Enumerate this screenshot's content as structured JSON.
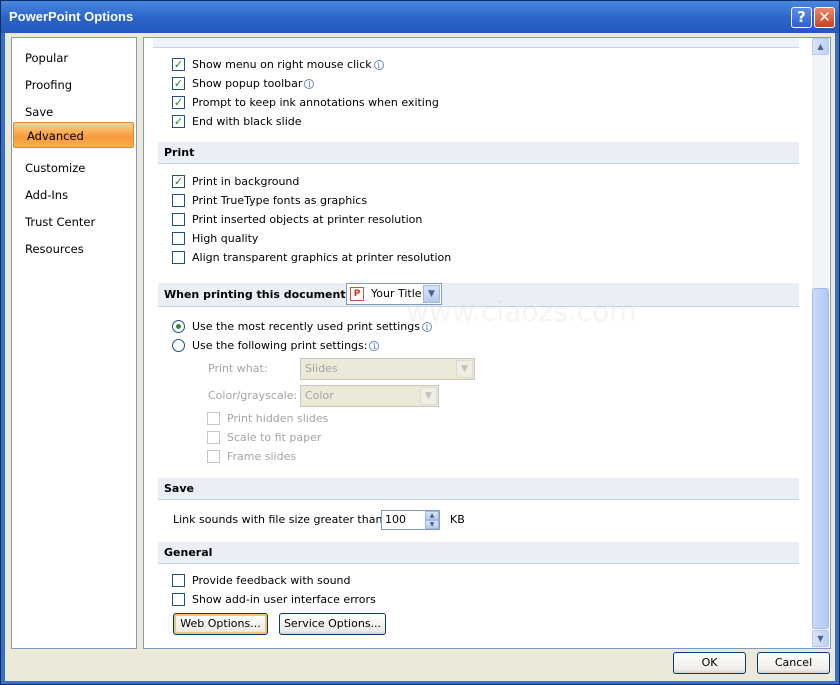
{
  "window": {
    "title": "PowerPoint Options",
    "help_glyph": "?",
    "close_glyph": "✕"
  },
  "nav": {
    "items": [
      {
        "label": "Popular"
      },
      {
        "label": "Proofing"
      },
      {
        "label": "Save"
      },
      {
        "label": "Advanced",
        "selected": true
      },
      {
        "label": "Customize"
      },
      {
        "label": "Add-Ins"
      },
      {
        "label": "Trust Center"
      },
      {
        "label": "Resources"
      }
    ]
  },
  "display": {
    "options": [
      {
        "label": "Show menu on right mouse click",
        "checked": true,
        "info": true
      },
      {
        "label": "Show popup toolbar",
        "checked": true,
        "info": true
      },
      {
        "label": "Prompt to keep ink annotations when exiting",
        "checked": true
      },
      {
        "label": "End with black slide",
        "checked": true
      }
    ]
  },
  "print": {
    "heading": "Print",
    "options": [
      {
        "label": "Print in background",
        "checked": true
      },
      {
        "label": "Print TrueType fonts as graphics",
        "checked": false
      },
      {
        "label": "Print inserted objects at printer resolution",
        "checked": false
      },
      {
        "label": "High quality",
        "checked": false
      },
      {
        "label": "Align transparent graphics at printer resolution",
        "checked": false
      }
    ]
  },
  "when_printing": {
    "heading": "When printing this document:",
    "document": "Your Title",
    "radio_recent": "Use the most recently used print settings",
    "radio_following": "Use the following print settings:",
    "selected": "recent",
    "print_what_label": "Print what:",
    "print_what_value": "Slides",
    "color_label": "Color/grayscale:",
    "color_value": "Color",
    "sub_options": [
      {
        "label": "Print hidden slides",
        "checked": false
      },
      {
        "label": "Scale to fit paper",
        "checked": false
      },
      {
        "label": "Frame slides",
        "checked": false
      }
    ]
  },
  "save": {
    "heading": "Save",
    "link_label": "Link sounds with file size greater than:",
    "link_value": "100",
    "unit": "KB"
  },
  "general": {
    "heading": "General",
    "options": [
      {
        "label": "Provide feedback with sound",
        "checked": false
      },
      {
        "label": "Show add-in user interface errors",
        "checked": false
      }
    ],
    "web_options": "Web Options...",
    "service_options": "Service Options..."
  },
  "footer": {
    "ok": "OK",
    "cancel": "Cancel"
  },
  "colors": {
    "accent": "#2459bd",
    "selected_nav": "#f59a3a",
    "check": "#218021"
  },
  "watermark": "www.ciaozs.com"
}
